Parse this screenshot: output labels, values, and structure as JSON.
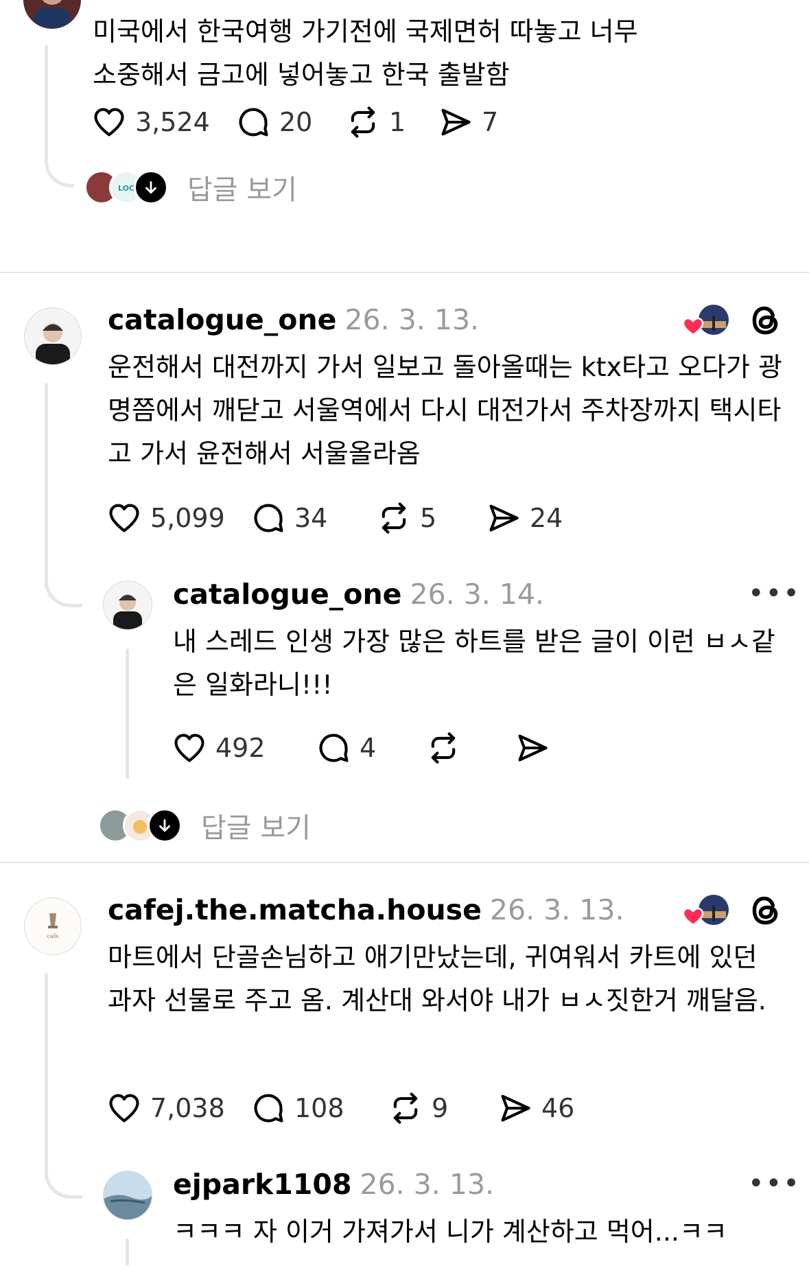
{
  "posts": [
    {
      "text": "미국에서 한국여행 가기전에 국제면허 따놓고 너무 소중해서 금고에 넣어놓고 한국 출발함",
      "likes": "3,524",
      "comments": "20",
      "reposts": "1",
      "shares": "7",
      "view_replies": "답글 보기"
    },
    {
      "username": "catalogue_one",
      "date": "26. 3. 13.",
      "text": "운전해서 대전까지 가서 일보고 돌아올때는 ktx타고 오다가  광명쯤에서 깨닫고 서울역에서 다시 대전가서 주차장까지 택시타고 가서 윤전해서 서울올라옴",
      "likes": "5,099",
      "comments": "34",
      "reposts": "5",
      "shares": "24",
      "reply": {
        "username": "catalogue_one",
        "date": "26. 3. 14.",
        "text": "내 스레드 인생 가장 많은 하트를 받은 글이 이런 ㅂㅅ같은 일화라니!!!",
        "likes": "492",
        "comments": "4",
        "more": "•••"
      },
      "view_replies": "답글 보기"
    },
    {
      "username": "cafej.the.matcha.house",
      "date": "26. 3. 13.",
      "text": "마트에서 단골손님하고 애기만났는데, 귀여워서 카트에 있던 과자 선물로 주고 옴. 계산대 와서야 내가 ㅂㅅ짓한거 깨달음.",
      "likes": "7,038",
      "comments": "108",
      "reposts": "9",
      "shares": "46",
      "reply": {
        "username": "ejpark1108",
        "date": "26. 3. 13.",
        "text": "ㅋㅋㅋ 자 이거 가져가서 니가 계산하고 먹어...ㅋㅋ",
        "more": "•••"
      }
    }
  ],
  "colors": {
    "heart": "#ff2d55",
    "divider": "#e6e6e6",
    "muted": "#9a9a9a"
  }
}
